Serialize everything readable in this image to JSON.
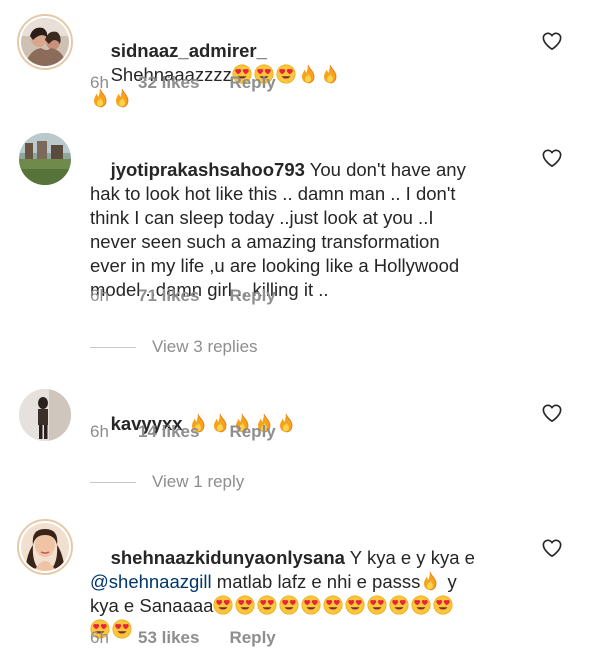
{
  "comments": [
    {
      "username": "sidnaaz_admirer_",
      "text": "Shehnaaazzzz",
      "emojis_line1": [
        "heart-eyes",
        "heart-eyes",
        "heart-eyes",
        "fire",
        "fire"
      ],
      "emojis_line2": [
        "fire",
        "fire"
      ],
      "time": "6h",
      "likes": "32 likes",
      "reply": "Reply"
    },
    {
      "username": "jyotiprakashsahoo793",
      "text": "You don't have any\nhak to look hot like this .. damn man .. I don't\nthink I can sleep today ..just look at you ..I\nnever seen such a amazing transformation\never in my life ,u are looking like a Hollywood\nmodel ..damn girl .. killing it ..",
      "time": "6h",
      "likes": "71 likes",
      "reply": "Reply",
      "view_replies": "View 3 replies"
    },
    {
      "username": "kavyyxx",
      "emojis_line1": [
        "fire",
        "fire",
        "fire",
        "fire",
        "fire"
      ],
      "time": "6h",
      "likes": "14 likes",
      "reply": "Reply",
      "view_replies": "View 1 reply"
    },
    {
      "username": "shehnaazkidunyaonlysana",
      "text_a": "Y kya e y kya e",
      "mention": "@shehnaazgill",
      "text_b": "matlab lafz e nhi e passs",
      "text_c": "y",
      "text_d": "kya e Sanaaaa",
      "time": "6h",
      "likes": "53 likes",
      "reply": "Reply"
    }
  ],
  "colors": {
    "text": "#262626",
    "secondary": "#8e8e8e",
    "mention": "#00376b"
  },
  "icons": [
    "heart-outline-icon",
    "fire-emoji",
    "heart-eyes-emoji"
  ]
}
